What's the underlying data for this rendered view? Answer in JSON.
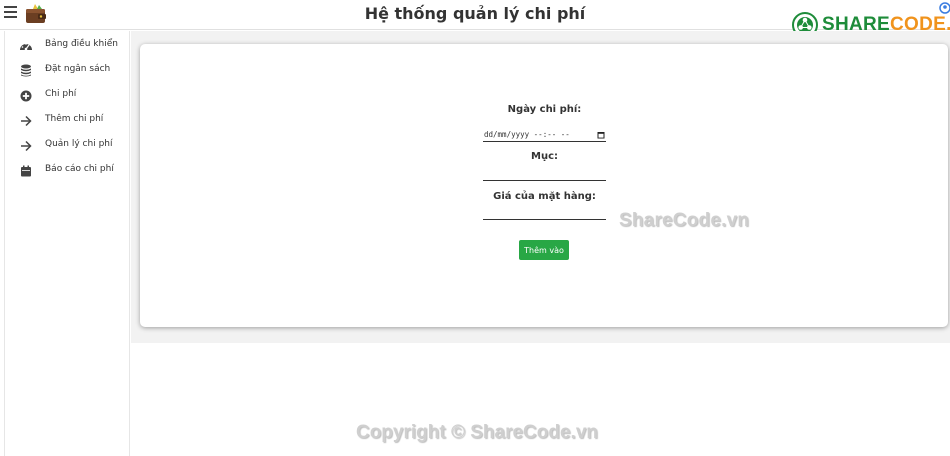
{
  "header": {
    "title": "Hệ thống quản lý chi phí",
    "brand_part1": "SHARE",
    "brand_part2": "CODE.vn"
  },
  "sidebar": {
    "items": [
      {
        "label": "Bảng điều khiển",
        "icon": "dashboard-icon"
      },
      {
        "label": "Đặt ngân sách",
        "icon": "coins-icon"
      },
      {
        "label": "Chi phí",
        "icon": "plus-circle-icon"
      },
      {
        "label": "Thêm chi phí",
        "icon": "arrow-right-icon"
      },
      {
        "label": "Quản lý chi phí",
        "icon": "arrow-right-icon"
      },
      {
        "label": "Báo cáo chi phí",
        "icon": "calendar-icon"
      }
    ]
  },
  "form": {
    "date_label": "Ngày chi phí:",
    "date_placeholder": "dd/mm/yyyy --:-- --",
    "category_label": "Mục:",
    "category_value": "",
    "price_label": "Giá của mặt hàng:",
    "price_value": "",
    "submit_label": "Thêm vào"
  },
  "watermarks": {
    "middle": "ShareCode.vn",
    "bottom": "Copyright © ShareCode.vn"
  },
  "colors": {
    "accent_green": "#28a745",
    "brand_green": "#1e8c3a",
    "brand_orange": "#f0931c",
    "content_bg": "#f2f2f2"
  }
}
